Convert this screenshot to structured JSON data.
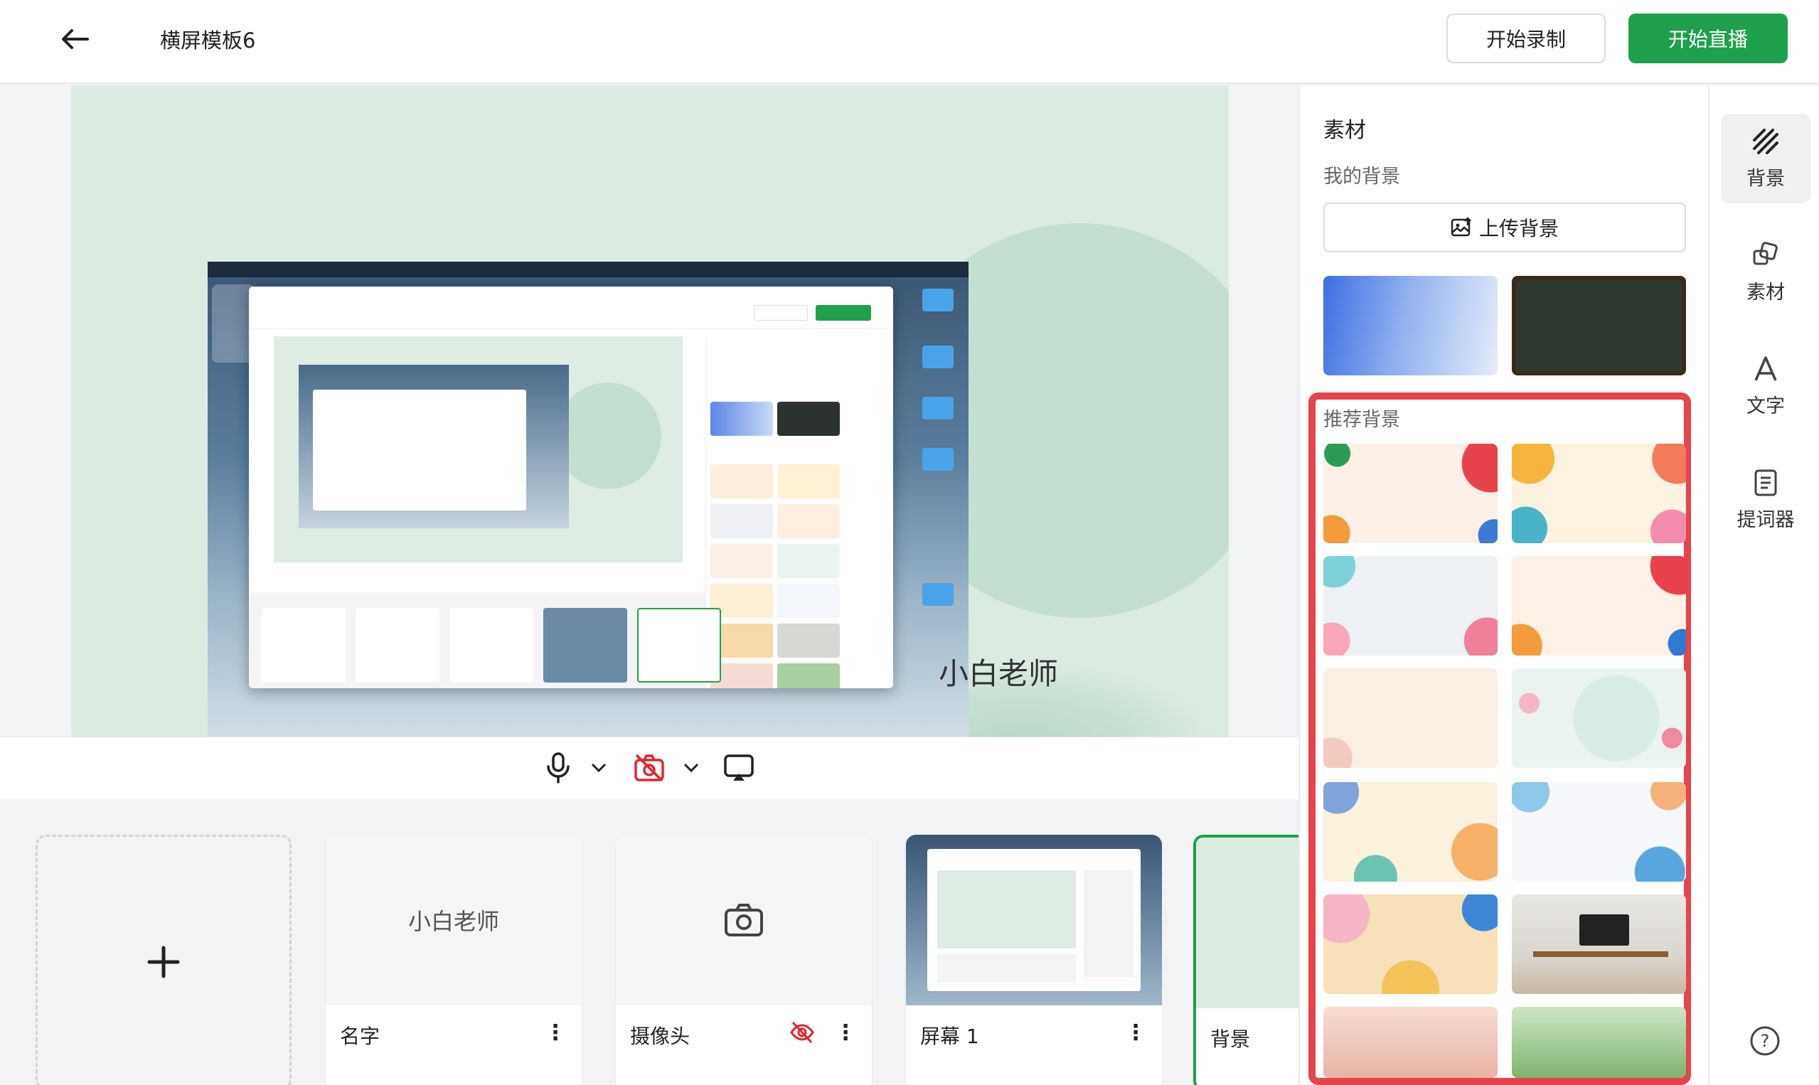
{
  "header": {
    "title": "横屏模板6",
    "record_label": "开始录制",
    "live_label": "开始直播"
  },
  "stage": {
    "presenter_name": "小白老师"
  },
  "sources": [
    {
      "label": "名字",
      "preview_text": "小白老师"
    },
    {
      "label": "摄像头"
    },
    {
      "label": "屏幕 1"
    },
    {
      "label": "背景"
    }
  ],
  "add_icon": "+",
  "more_icon": "⋮",
  "panel": {
    "title": "素材",
    "my_bg_label": "我的背景",
    "upload_label": "上传背景",
    "recommended_label": "推荐背景"
  },
  "tabs": [
    {
      "label": "背景",
      "icon": "stripes-icon",
      "active": true
    },
    {
      "label": "素材",
      "icon": "shapes-icon"
    },
    {
      "label": "文字",
      "icon": "text-a-icon"
    },
    {
      "label": "提词器",
      "icon": "document-icon"
    }
  ],
  "help_icon": "?",
  "colors": {
    "accent_green": "#1fa04a",
    "highlight_red": "#e8424a",
    "stage_bg": "#dcebe2"
  }
}
